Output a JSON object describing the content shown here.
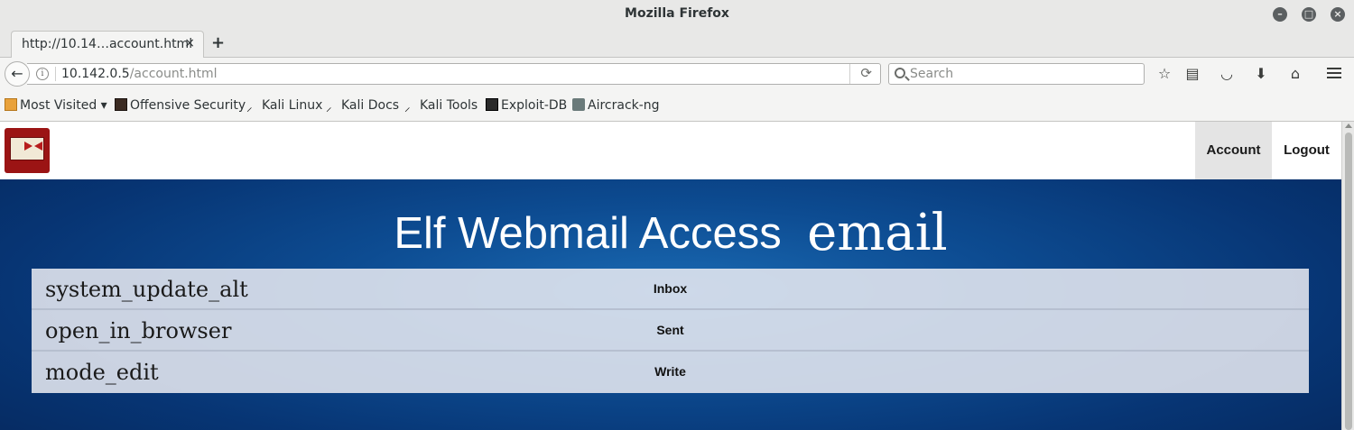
{
  "window": {
    "title": "Mozilla Firefox"
  },
  "tabs": [
    {
      "label": "http://10.14…account.html",
      "close": "×"
    }
  ],
  "new_tab": "+",
  "nav": {
    "url_host": "10.142.0.5",
    "url_path": "/account.html",
    "search_placeholder": "Search"
  },
  "bookmarks": [
    {
      "label": "Most Visited ▾",
      "icon": "folder-icon"
    },
    {
      "label": "Offensive Security",
      "icon": "offsec-icon"
    },
    {
      "label": "Kali Linux",
      "icon": "kali-icon"
    },
    {
      "label": "Kali Docs",
      "icon": "kali-icon"
    },
    {
      "label": "Kali Tools",
      "icon": "kali-icon"
    },
    {
      "label": "Exploit-DB",
      "icon": "exploitdb-icon"
    },
    {
      "label": "Aircrack-ng",
      "icon": "aircrack-icon"
    }
  ],
  "site": {
    "nav_account": "Account",
    "nav_logout": "Logout",
    "heading_title": "Elf Webmail Access",
    "heading_icon": "email",
    "menu": [
      {
        "icon": "system_update_alt",
        "label": "Inbox"
      },
      {
        "icon": "open_in_browser",
        "label": "Sent"
      },
      {
        "icon": "mode_edit",
        "label": "Write"
      }
    ]
  },
  "colors": {
    "page_bg": "#0d4c92",
    "menu_bg": "#e6e8f0",
    "active_nav_bg": "#e4e4e4",
    "logo": "#9b1414"
  }
}
